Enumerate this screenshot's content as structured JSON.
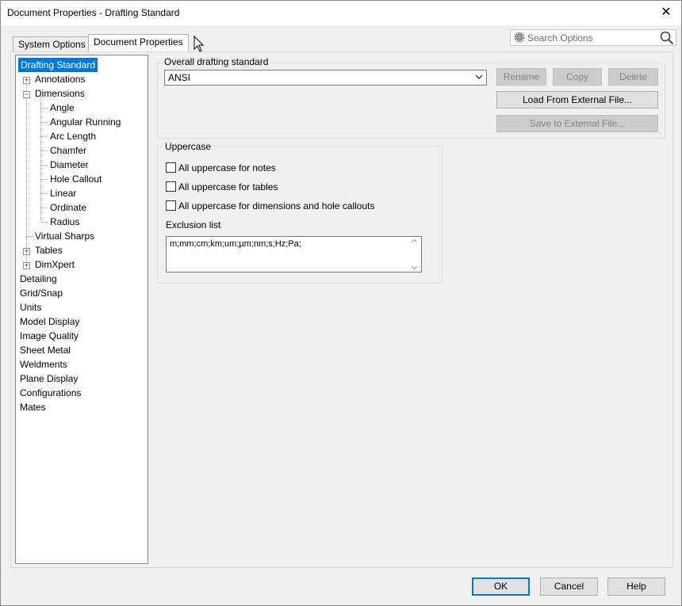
{
  "window": {
    "title": "Document Properties - Drafting Standard",
    "close_glyph": "✕"
  },
  "tabs": [
    {
      "label": "System Options"
    },
    {
      "label": "Document Properties"
    }
  ],
  "search": {
    "placeholder": "Search Options"
  },
  "tree": {
    "items": [
      {
        "label": "Drafting Standard"
      },
      {
        "label": "Annotations",
        "expander": "+"
      },
      {
        "label": "Dimensions",
        "expander": "−"
      },
      {
        "label": "Angle"
      },
      {
        "label": "Angular Running"
      },
      {
        "label": "Arc Length"
      },
      {
        "label": "Chamfer"
      },
      {
        "label": "Diameter"
      },
      {
        "label": "Hole Callout"
      },
      {
        "label": "Linear"
      },
      {
        "label": "Ordinate"
      },
      {
        "label": "Radius"
      },
      {
        "label": "Virtual Sharps"
      },
      {
        "label": "Tables",
        "expander": "+"
      },
      {
        "label": "DimXpert",
        "expander": "+"
      },
      {
        "label": "Detailing"
      },
      {
        "label": "Grid/Snap"
      },
      {
        "label": "Units"
      },
      {
        "label": "Model Display"
      },
      {
        "label": "Image Quality"
      },
      {
        "label": "Sheet Metal"
      },
      {
        "label": "Weldments"
      },
      {
        "label": "Plane Display"
      },
      {
        "label": "Configurations"
      },
      {
        "label": "Mates"
      }
    ]
  },
  "standard": {
    "group_title": "Overall drafting standard",
    "selected": "ANSI",
    "buttons": {
      "rename": "Rename",
      "copy": "Copy",
      "delete": "Delete",
      "load": "Load From External File...",
      "save": "Save to External File..."
    }
  },
  "uppercase": {
    "group_title": "Uppercase",
    "checkboxes": [
      {
        "label": "All uppercase for notes",
        "checked": false
      },
      {
        "label": "All uppercase for tables",
        "checked": false
      },
      {
        "label": "All uppercase for dimensions and hole callouts",
        "checked": false
      }
    ],
    "exclusion_label": "Exclusion list",
    "exclusion_value": "m;mm;cm;km;um;µm;nm;s;Hz;Pa;"
  },
  "footer": {
    "ok": "OK",
    "cancel": "Cancel",
    "help": "Help"
  },
  "colors": {
    "selection": "#0078d7",
    "default_button_border": "#0078d7"
  }
}
